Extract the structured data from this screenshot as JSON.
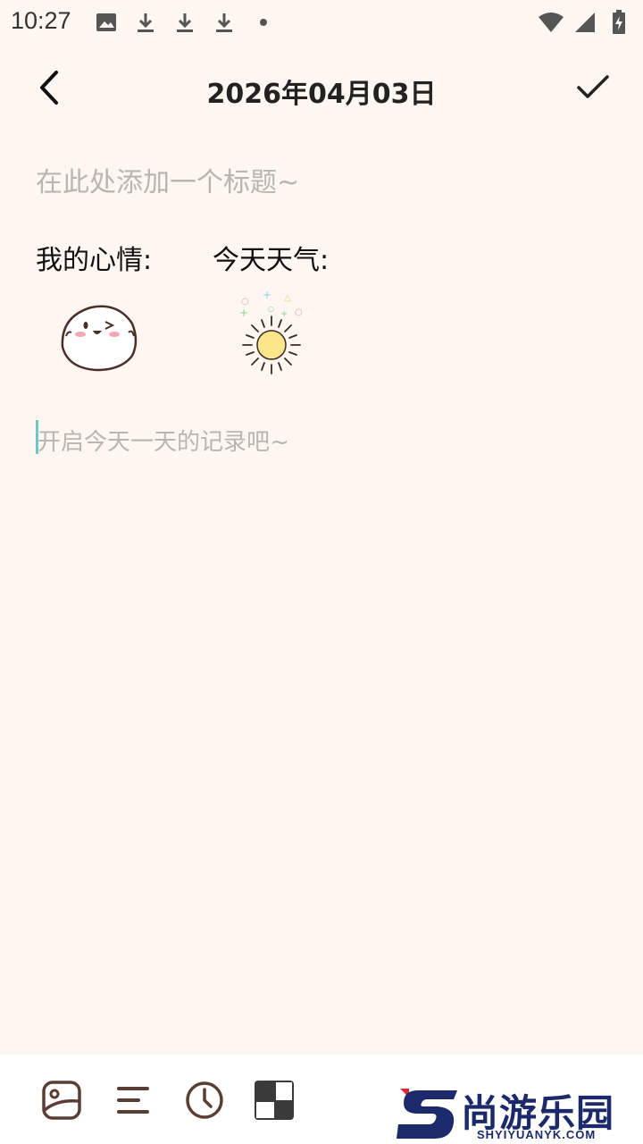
{
  "status_bar": {
    "time": "10:27",
    "left_icons": [
      "image-icon",
      "download-icon",
      "download-icon",
      "download-icon",
      "dot-icon"
    ],
    "right_icons": [
      "wifi-icon",
      "signal-icon",
      "battery-charging-icon"
    ]
  },
  "header": {
    "title": "2026年04月03日",
    "back_icon": "chevron-left-icon",
    "confirm_icon": "check-icon"
  },
  "entry": {
    "title_placeholder": "在此处添加一个标题~",
    "mood_label": "我的心情:",
    "weather_label": "今天天气:",
    "selected_mood": "happy-face",
    "selected_weather": "sunny",
    "content_placeholder": "开启今天一天的记录吧~"
  },
  "toolbar": {
    "tools": [
      "image-icon",
      "text-align-icon",
      "clock-icon",
      "template-icon"
    ]
  },
  "watermark": {
    "text": "尚游乐园",
    "sub": "SHYIYUANYK.COM"
  },
  "colors": {
    "background": "#fdf6f1",
    "cursor": "#6bc7c0",
    "placeholder": "#b9b5b2",
    "icon": "#5a3e35"
  }
}
